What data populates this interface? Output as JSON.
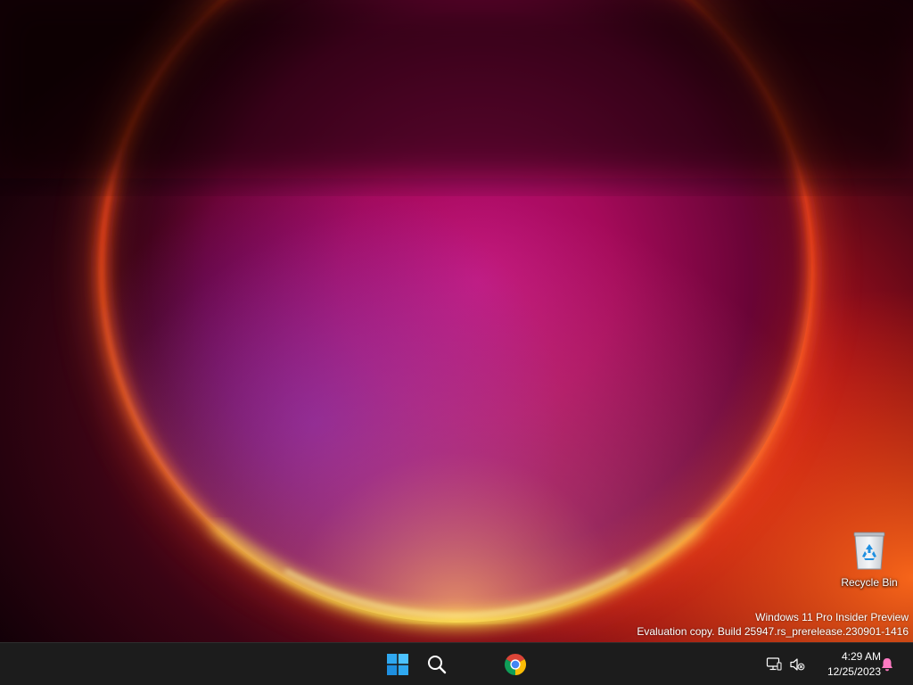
{
  "desktop": {
    "icons": [
      {
        "label": "Recycle Bin",
        "icon": "recycle-bin-icon"
      }
    ],
    "watermark": {
      "line1": "Windows 11 Pro Insider Preview",
      "line2": "Evaluation copy. Build 25947.rs_prerelease.230901-1416"
    }
  },
  "taskbar": {
    "buttons": [
      {
        "name": "start-button",
        "icon": "windows-logo-icon",
        "color": "#2fa8f0"
      },
      {
        "name": "search-button",
        "icon": "search-icon"
      },
      {
        "name": "chrome-button",
        "icon": "chrome-icon"
      }
    ],
    "tray": {
      "icons": [
        "network-icon",
        "volume-muted-icon",
        "notification-bell-icon"
      ],
      "bell_color": "#ff7ac3"
    },
    "clock": {
      "time": "4:29 AM",
      "date": "12/25/2023"
    }
  },
  "colors": {
    "taskbar_bg": "#1c1c1c",
    "wallpaper_accent_magenta": "#c0127c",
    "wallpaper_accent_orange": "#ff6a1a"
  }
}
